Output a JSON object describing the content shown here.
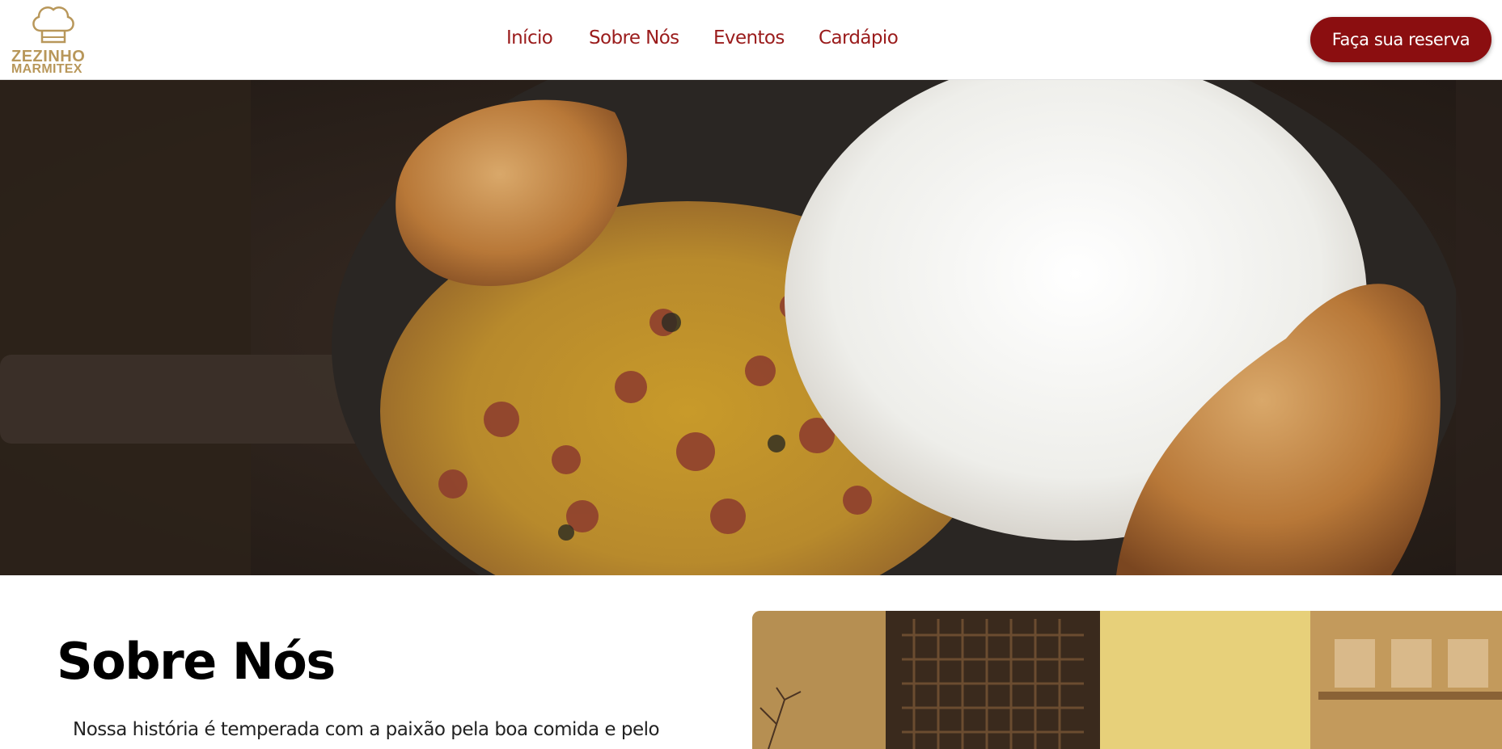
{
  "brand": {
    "logo_line1": "ZEZINHO",
    "logo_line2": "MARMITEX",
    "logo_icon": "chef-hat-icon",
    "color_gold": "#b8975a"
  },
  "nav": {
    "items": [
      {
        "label": "Início"
      },
      {
        "label": "Sobre Nós"
      },
      {
        "label": "Eventos"
      },
      {
        "label": "Cardápio"
      }
    ],
    "color": "#9a1b1b"
  },
  "header": {
    "reserve_label": "Faça sua reserva",
    "reserve_color": "#8b0e10"
  },
  "about": {
    "title": "Sobre Nós",
    "text": "Nossa história é temperada com a paixão pela boa comida e pelo"
  }
}
